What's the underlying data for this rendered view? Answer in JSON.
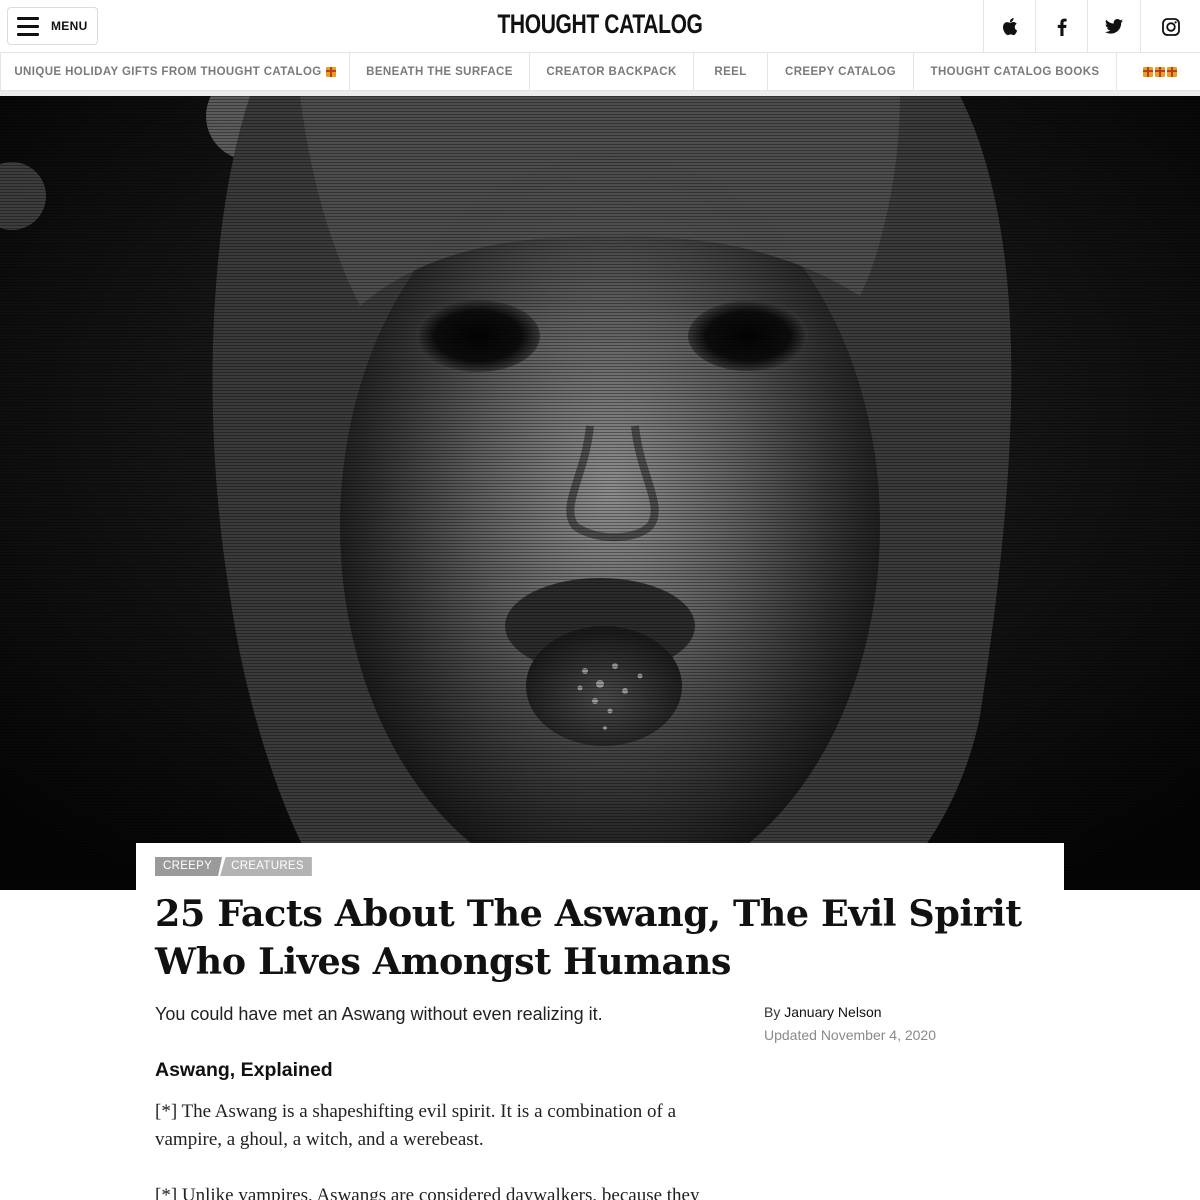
{
  "header": {
    "menu_label": "MENU",
    "logo": "THOUGHT CATALOG",
    "social": [
      "apple-icon",
      "facebook-icon",
      "twitter-icon",
      "instagram-icon"
    ]
  },
  "nav": {
    "items": [
      "UNIQUE HOLIDAY GIFTS FROM THOUGHT CATALOG",
      "BENEATH THE SURFACE",
      "CREATOR BACKPACK",
      "REEL",
      "CREEPY CATALOG",
      "THOUGHT CATALOG BOOKS"
    ]
  },
  "article": {
    "tags": [
      "CREEPY",
      "CREATURES"
    ],
    "title": "25 Facts About The Aswang, The Evil Spirit Who Lives Amongst Humans",
    "dek": "You could have met an Aswang without even realizing it.",
    "byline_prefix": "By",
    "author": "January Nelson",
    "updated": "Updated November 4, 2020",
    "subhead": "Aswang, Explained",
    "paragraphs": [
      "[*] The Aswang is a shapeshifting evil spirit. It is a combination of a vampire, a ghoul, a witch, and a werebeast.",
      "[*] Unlike vampires, Aswangs are considered daywalkers, because they"
    ]
  },
  "colors": {
    "nav_text": "#7a7a7a",
    "tag_primary": "#9a9a9a",
    "tag_secondary": "#b3b3b3",
    "updated_text": "#8a8a8a"
  }
}
